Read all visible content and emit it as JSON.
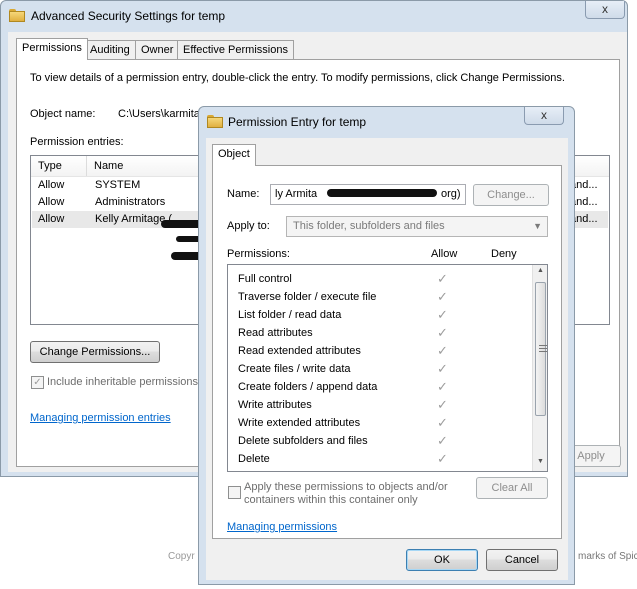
{
  "back_window": {
    "title": "Advanced Security Settings for temp",
    "close_label": "x",
    "tabs": [
      "Permissions",
      "Auditing",
      "Owner",
      "Effective Permissions"
    ],
    "instructions": "To view details of a permission entry, double-click the entry. To modify permissions, click Change Permissions.",
    "object_name_label": "Object name:",
    "object_name_value": "C:\\Users\\karmita",
    "permission_entries_label": "Permission entries:",
    "columns": [
      "Type",
      "Name"
    ],
    "rows": [
      {
        "type": "Allow",
        "name": "SYSTEM",
        "tail": "and..."
      },
      {
        "type": "Allow",
        "name": "Administrators",
        "tail": "and..."
      },
      {
        "type": "Allow",
        "name": "Kelly Armitage (",
        "tail": "and..."
      }
    ],
    "change_permissions_button": "Change Permissions...",
    "include_inheritable": "Include inheritable permissions fr",
    "managing_link": "Managing permission entries",
    "apply_button": "Apply"
  },
  "behind_text": {
    "copyright": "Copyr",
    "trademarks": "marks of Spice"
  },
  "front_window": {
    "title": "Permission Entry for temp",
    "close_label": "x",
    "tab_object": "Object",
    "name_label": "Name:",
    "name_value": "ly Armita",
    "name_value_tail": "org)",
    "change_button": "Change...",
    "apply_to_label": "Apply to:",
    "apply_to_value": "This folder, subfolders and files",
    "permissions_label": "Permissions:",
    "allow_header": "Allow",
    "deny_header": "Deny",
    "permissions": [
      {
        "name": "Full control",
        "allow": "✓"
      },
      {
        "name": "Traverse folder / execute file",
        "allow": "✓"
      },
      {
        "name": "List folder / read data",
        "allow": "✓"
      },
      {
        "name": "Read attributes",
        "allow": "✓"
      },
      {
        "name": "Read extended attributes",
        "allow": "✓"
      },
      {
        "name": "Create files / write data",
        "allow": "✓"
      },
      {
        "name": "Create folders / append data",
        "allow": "✓"
      },
      {
        "name": "Write attributes",
        "allow": "✓"
      },
      {
        "name": "Write extended attributes",
        "allow": "✓"
      },
      {
        "name": "Delete subfolders and files",
        "allow": "✓"
      },
      {
        "name": "Delete",
        "allow": "✓"
      }
    ],
    "apply_these_line1": "Apply these permissions to objects and/or",
    "apply_these_line2": "containers within this container only",
    "clear_all_button": "Clear All",
    "managing_link": "Managing permissions",
    "ok_button": "OK",
    "cancel_button": "Cancel"
  }
}
